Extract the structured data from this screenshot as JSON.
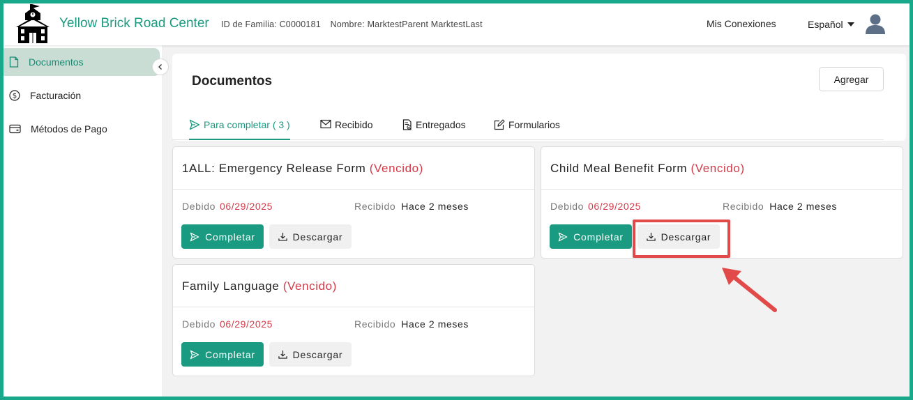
{
  "header": {
    "app_title": "Yellow Brick Road Center",
    "family_id": "ID de Familia: C0000181",
    "family_name": "Nombre: MarktestParent MarktestLast",
    "connections_label": "Mis Conexiones",
    "language_label": "Español"
  },
  "sidebar": {
    "items": [
      {
        "label": "Documentos",
        "icon": "document-icon",
        "active": true
      },
      {
        "label": "Facturación",
        "icon": "dollar-circle-icon",
        "active": false
      },
      {
        "label": "Métodos de Pago",
        "icon": "wallet-icon",
        "active": false
      }
    ]
  },
  "main": {
    "title": "Documentos",
    "add_label": "Agregar",
    "tabs": [
      {
        "label": "Para completar ( 3 )",
        "icon": "send-icon",
        "active": true
      },
      {
        "label": "Recibido",
        "icon": "mail-icon",
        "active": false
      },
      {
        "label": "Entregados",
        "icon": "document-check-icon",
        "active": false
      },
      {
        "label": "Formularios",
        "icon": "edit-icon",
        "active": false
      }
    ]
  },
  "cards": [
    {
      "title": "1ALL: Emergency Release Form",
      "status": "(Vencido)",
      "due_label": "Debido",
      "due_date": "06/29/2025",
      "received_label": "Recibido",
      "received_value": "Hace 2 meses",
      "complete_label": "Completar",
      "download_label": "Descargar"
    },
    {
      "title": "Child Meal Benefit Form",
      "status": "(Vencido)",
      "due_label": "Debido",
      "due_date": "06/29/2025",
      "received_label": "Recibido",
      "received_value": "Hace 2 meses",
      "complete_label": "Completar",
      "download_label": "Descargar"
    },
    {
      "title": "Family Language",
      "status": "(Vencido)",
      "due_label": "Debido",
      "due_date": "06/29/2025",
      "received_label": "Recibido",
      "received_value": "Hace 2 meses",
      "complete_label": "Completar",
      "download_label": "Descargar"
    }
  ],
  "colors": {
    "brand": "#1a9a80",
    "overdue": "#d23a48",
    "annotation": "#e24a4a",
    "frame": "#1aa88a"
  }
}
